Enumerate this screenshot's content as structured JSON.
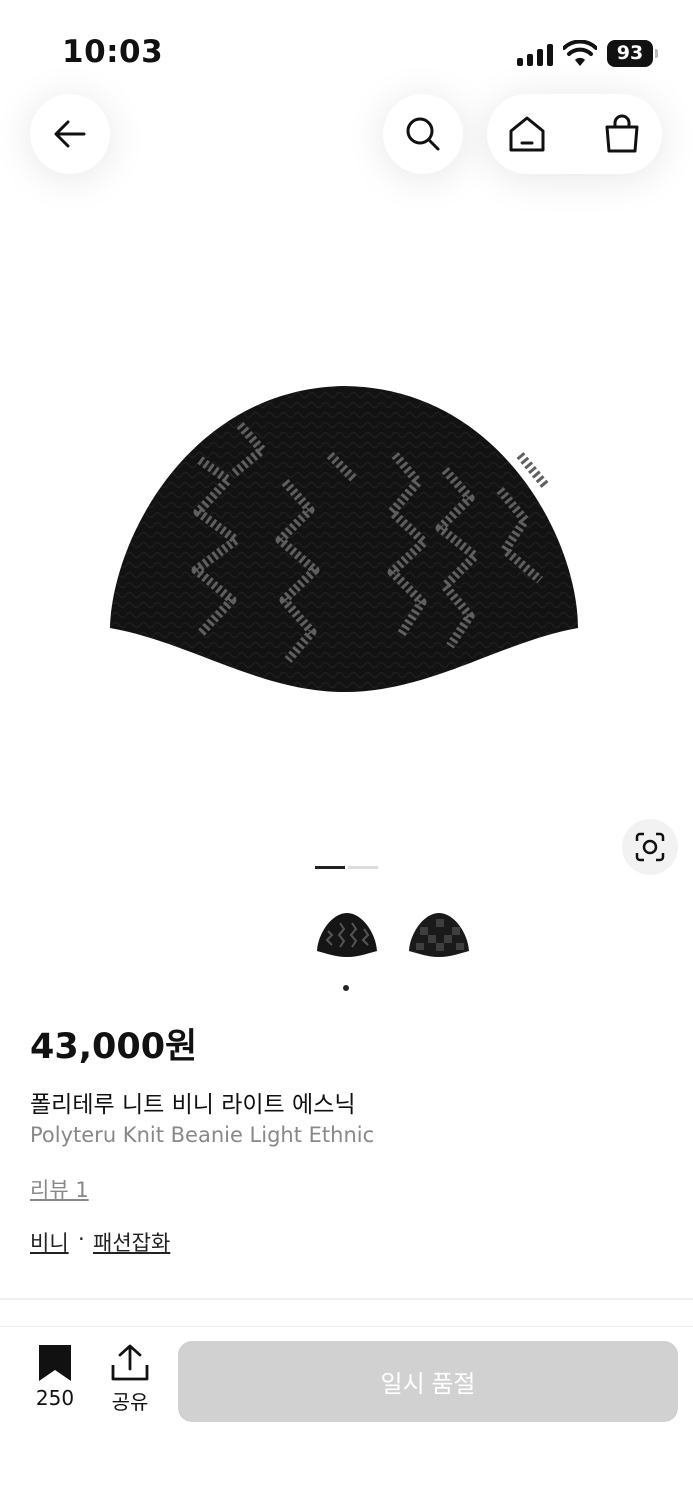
{
  "status_bar": {
    "time": "10:03",
    "battery": "93"
  },
  "nav": {
    "back_icon": "arrow-left-icon",
    "search_icon": "search-icon",
    "home_icon": "home-icon",
    "bag_icon": "shopping-bag-icon"
  },
  "gallery": {
    "image_description_icon": "product-beanie-image",
    "lens_icon": "visual-search-icon",
    "current_slide": 1,
    "total_slides": 2,
    "thumbnails": [
      "beanie-light-ethnic",
      "beanie-dark-check"
    ]
  },
  "product": {
    "price": "43,000원",
    "name_ko": "폴리테루 니트 비니 라이트 에스닉",
    "name_en": "Polyteru Knit Beanie Light Ethnic",
    "review_link": "리뷰 1",
    "category_1": "비니",
    "category_separator": "·",
    "category_2": "패션잡화"
  },
  "bottom_bar": {
    "bookmark_count": "250",
    "share_label": "공유",
    "soldout_label": "일시 품절"
  },
  "colors": {
    "soldout_bg": "#d1d1d1",
    "text_primary": "#111111",
    "text_secondary": "#888888"
  }
}
